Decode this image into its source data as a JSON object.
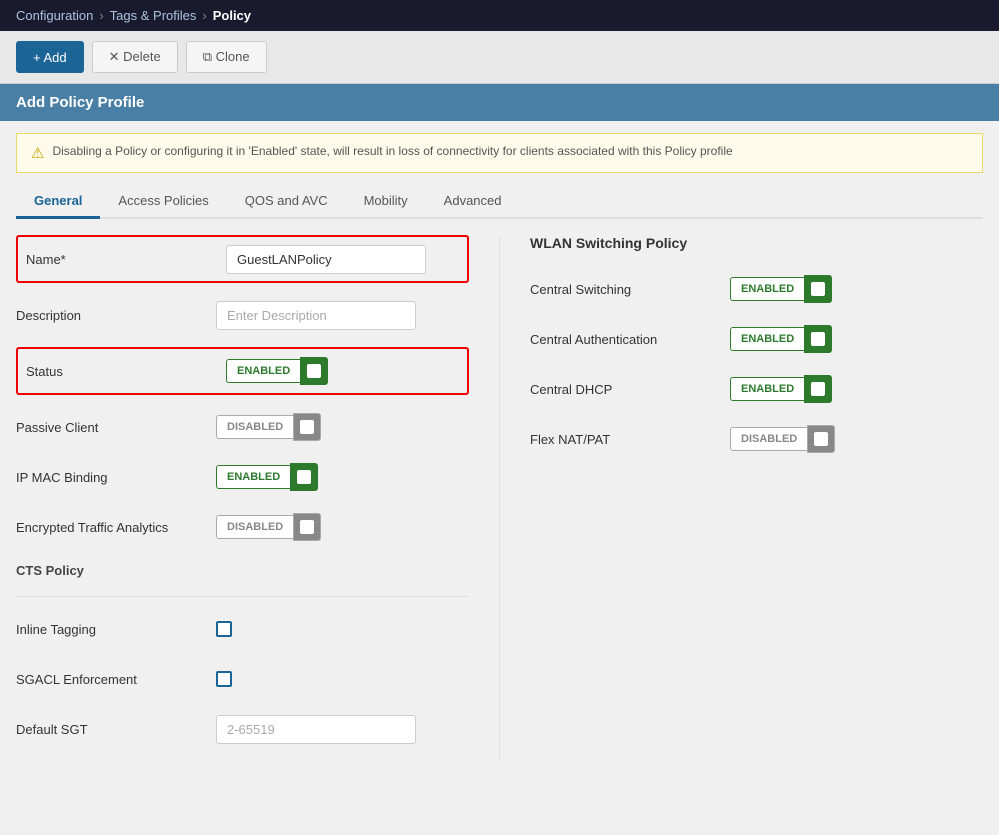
{
  "nav": {
    "items": [
      {
        "label": "Configuration",
        "href": "#"
      },
      {
        "label": "Tags & Profiles",
        "href": "#"
      },
      {
        "label": "Policy",
        "current": true
      }
    ]
  },
  "toolbar": {
    "add_label": "+ Add",
    "delete_label": "✕ Delete",
    "clone_label": "⧉ Clone"
  },
  "form_title": "Add Policy Profile",
  "alert": {
    "message": "Disabling a Policy or configuring it in 'Enabled' state, will result in loss of connectivity for clients associated with this Policy profile"
  },
  "tabs": [
    {
      "label": "General",
      "active": true
    },
    {
      "label": "Access Policies"
    },
    {
      "label": "QOS and AVC"
    },
    {
      "label": "Mobility"
    },
    {
      "label": "Advanced"
    }
  ],
  "form": {
    "name_label": "Name*",
    "name_value": "GuestLANPolicy",
    "description_label": "Description",
    "description_placeholder": "Enter Description",
    "status_label": "Status",
    "status_value": "ENABLED",
    "status_on": true,
    "passive_client_label": "Passive Client",
    "passive_client_value": "DISABLED",
    "passive_client_on": false,
    "ip_mac_label": "IP MAC Binding",
    "ip_mac_value": "ENABLED",
    "ip_mac_on": true,
    "enc_traffic_label": "Encrypted Traffic Analytics",
    "enc_traffic_value": "DISABLED",
    "enc_traffic_on": false,
    "cts_section": "CTS Policy",
    "inline_tagging_label": "Inline Tagging",
    "sgacl_label": "SGACL Enforcement",
    "default_sgt_label": "Default SGT",
    "default_sgt_placeholder": "2-65519"
  },
  "right": {
    "title": "WLAN Switching Policy",
    "central_switching_label": "Central Switching",
    "central_switching_value": "ENABLED",
    "central_switching_on": true,
    "central_auth_label": "Central Authentication",
    "central_auth_value": "ENABLED",
    "central_auth_on": true,
    "central_dhcp_label": "Central DHCP",
    "central_dhcp_value": "ENABLED",
    "central_dhcp_on": true,
    "flex_nat_label": "Flex NAT/PAT",
    "flex_nat_value": "DISABLED",
    "flex_nat_on": false
  }
}
